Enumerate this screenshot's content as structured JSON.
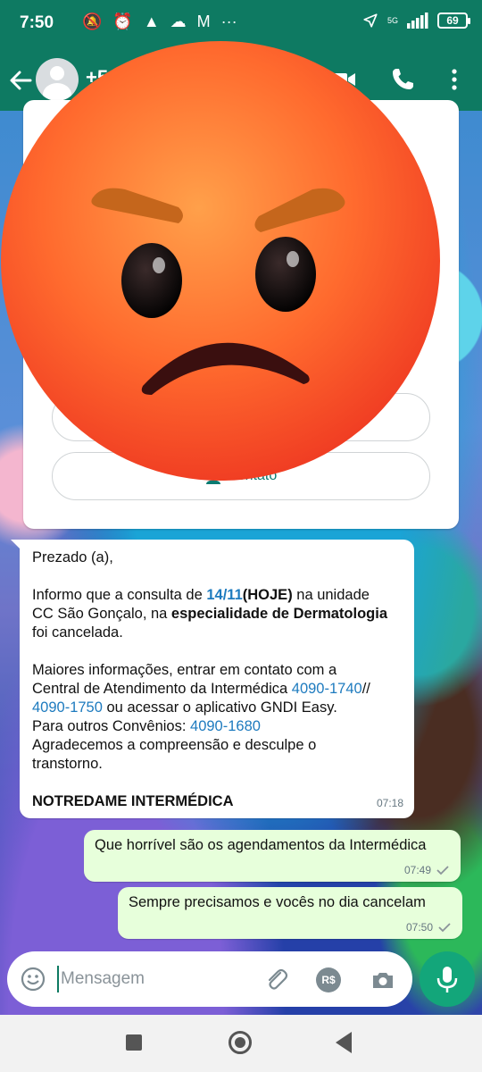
{
  "status": {
    "time": "7:50",
    "network": "5G",
    "battery": "69"
  },
  "header": {
    "contact_name": "+5"
  },
  "card": {
    "button1_label": "",
    "button2_label": "contato"
  },
  "message_in": {
    "greeting": "Prezado (a),",
    "line1_pre": "Informo que a consulta de ",
    "date": "14/11",
    "today": "(HOJE)",
    "line1_post": " na unidade",
    "line2_pre": "CC São Gonçalo,  na ",
    "specialty": "especialidade de Dermatologia",
    "line3": "foi cancelada.",
    "line4": "Maiores informações, entrar em contato com a",
    "line5_pre": "Central de Atendimento da Intermédica ",
    "phone1": "4090-1740",
    "line5_post": "//",
    "phone2": "4090-1750",
    "line6_post": " ou acessar o aplicativo GNDI Easy.",
    "line7_pre": "Para outros Convênios: ",
    "phone3": "4090-1680",
    "line8": "Agradecemos a compreensão e desculpe o",
    "line9": "transtorno.",
    "signature": "NOTREDAME INTERMÉDICA",
    "time": "07:18"
  },
  "messages_out": [
    {
      "text": "Que horrível são os agendamentos da Intermédica",
      "time": "07:49"
    },
    {
      "text": "Sempre precisamos e vocês no dia cancelam",
      "time": "07:50"
    }
  ],
  "input": {
    "placeholder": "Mensagem",
    "currency_label": "R$"
  },
  "colors": {
    "header": "#0e7a62",
    "accent": "#13a67a",
    "bubble_out": "#e7ffdb"
  },
  "icons": [
    "back-arrow-icon",
    "avatar-icon",
    "video-call-icon",
    "phone-icon",
    "more-vert-icon",
    "angry-face-emoji",
    "emoji-icon",
    "attach-icon",
    "camera-icon",
    "mic-icon"
  ]
}
